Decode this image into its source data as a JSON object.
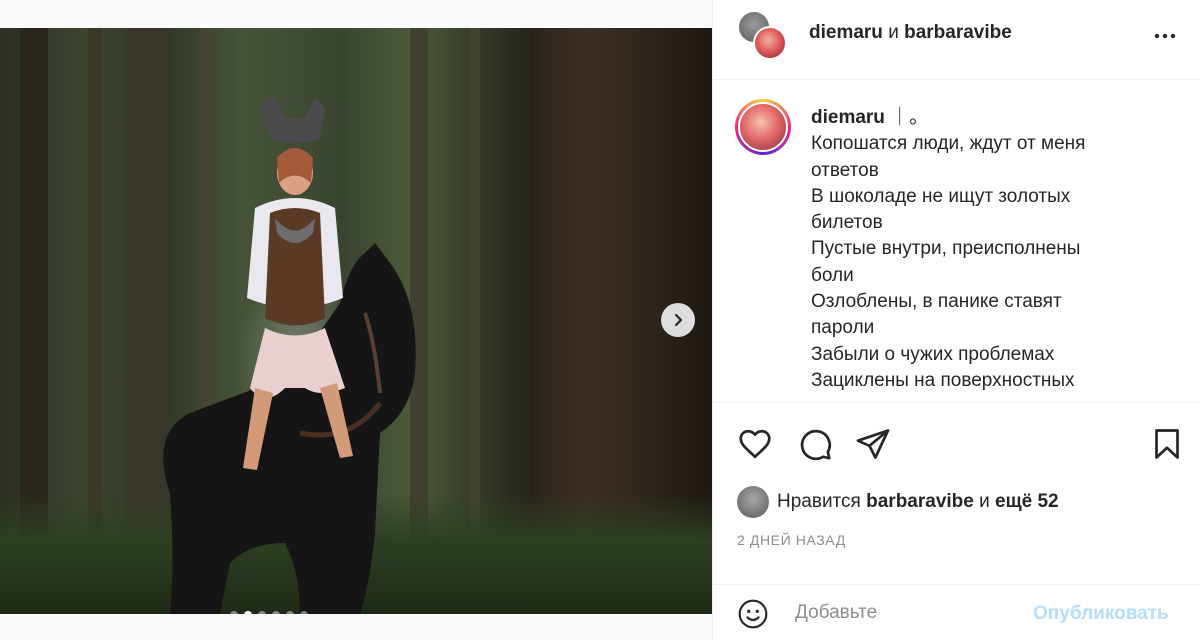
{
  "header": {
    "user1": "diemaru",
    "conjunction": "и",
    "user2": "barbaravibe",
    "more_icon": "more-horizontal-icon"
  },
  "caption": {
    "username": "diemaru",
    "suffix": "｜。",
    "lines": [
      "Копошатся люди, ждут от меня",
      "ответов",
      "В шоколаде не ищут золотых",
      "билетов",
      "Пустые внутри, преисполнены",
      "боли",
      "Озлоблены, в панике ставят",
      "пароли",
      "Забыли о чужих проблемах",
      "Зациклены на поверхностных"
    ]
  },
  "actions": {
    "like_icon": "heart-icon",
    "comment_icon": "comment-icon",
    "share_icon": "send-icon",
    "save_icon": "bookmark-icon"
  },
  "likes": {
    "prefix": "Нравится",
    "user": "barbaravibe",
    "middle": "и",
    "others": "ещё 52"
  },
  "timestamp": "2 ДНЕЙ НАЗАД",
  "comment": {
    "placeholder": "Добавьте",
    "publish_label": "Опубликовать"
  },
  "carousel": {
    "slide_count": 6,
    "active_index": 1
  },
  "colors": {
    "publish_disabled": "#b2dffc",
    "muted_text": "#8e8e8e",
    "border": "#efefef"
  }
}
